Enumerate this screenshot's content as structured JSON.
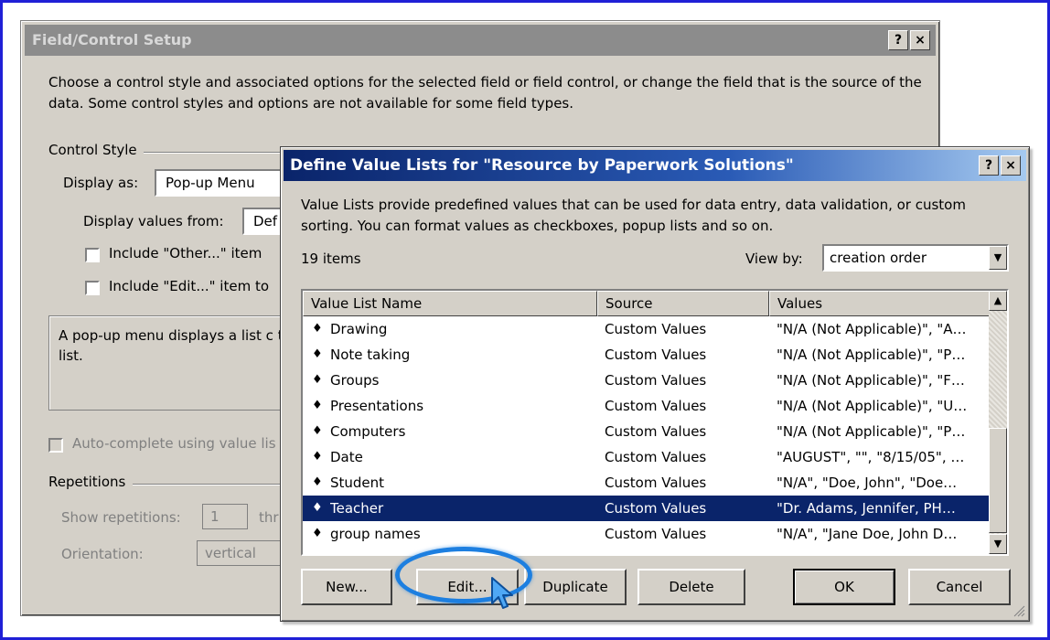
{
  "back_dialog": {
    "title": "Field/Control Setup",
    "help_btn": "?",
    "close_btn": "×",
    "description": "Choose a control style and associated options for the selected field or field control, or change the field that is the source of the data. Some control styles and options are not available for some field types.",
    "control_style_label": "Control Style",
    "display_as_label": "Display as:",
    "display_as_value": "Pop-up Menu",
    "display_values_from_label": "Display values from:",
    "display_values_from_value": "Def",
    "include_other_label": "Include \"Other...\" item",
    "include_edit_label": "Include \"Edit...\" item to",
    "info_text": "A pop-up menu displays a list c the list.",
    "autocomplete_label": "Auto-complete using value lis",
    "repetitions_label": "Repetitions",
    "show_repetitions_label": "Show repetitions:",
    "show_repetitions_value": "1",
    "through_label": "thr",
    "orientation_label": "Orientation:",
    "orientation_value": "vertical"
  },
  "front_dialog": {
    "title": "Define Value Lists for \"Resource by Paperwork Solutions\"",
    "help_btn": "?",
    "close_btn": "×",
    "description": "Value Lists provide predefined values that can be used for data entry, data validation, or custom sorting. You can format values as checkboxes, popup lists and so on.",
    "item_count": "19 items",
    "view_by_label": "View by:",
    "view_by_value": "creation order",
    "columns": [
      "Value List Name",
      "Source",
      "Values"
    ],
    "rows": [
      {
        "name": "Drawing",
        "source": "Custom Values",
        "values": "\"N/A (Not Applicable)\", \"A…"
      },
      {
        "name": "Note taking",
        "source": "Custom Values",
        "values": "\"N/A (Not Applicable)\", \"P…"
      },
      {
        "name": "Groups",
        "source": "Custom Values",
        "values": "\"N/A (Not Applicable)\", \"F…"
      },
      {
        "name": "Presentations",
        "source": "Custom Values",
        "values": "\"N/A (Not Applicable)\", \"U…"
      },
      {
        "name": "Computers",
        "source": "Custom Values",
        "values": "\"N/A (Not Applicable)\", \"P…"
      },
      {
        "name": "Date",
        "source": "Custom Values",
        "values": "\"AUGUST\", \"\", \"8/15/05\", …"
      },
      {
        "name": "Student",
        "source": "Custom Values",
        "values": "\"N/A\", \"Doe, John\", \"Doe…"
      },
      {
        "name": "Teacher",
        "source": "Custom Values",
        "values": "\"Dr. Adams, Jennifer, PH…",
        "selected": true
      },
      {
        "name": "group names",
        "source": "Custom Values",
        "values": "\"N/A\", \"Jane Doe, John D…"
      }
    ],
    "buttons": {
      "new": "New...",
      "edit": "Edit...",
      "duplicate": "Duplicate",
      "delete": "Delete",
      "ok": "OK",
      "cancel": "Cancel"
    }
  },
  "colors": {
    "frame_border": "#1f1fd6",
    "dialog_face": "#d4d0c8",
    "active_title": "#0a246a",
    "highlight_ring": "#1d7fe0"
  }
}
